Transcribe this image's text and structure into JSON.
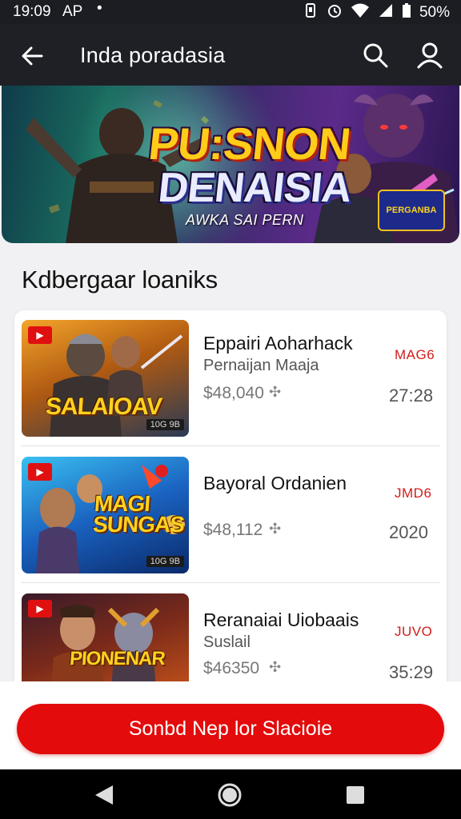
{
  "status_bar": {
    "time": "19:09",
    "carrier": "AP",
    "battery": "50%"
  },
  "app_bar": {
    "title": "Inda poradasia"
  },
  "banner": {
    "title_line1": "PU:SNON",
    "title_line2": "DENAISIA",
    "subtitle": "AWKA SAI PERN",
    "badge_text": "PERGANBA"
  },
  "section": {
    "heading": "Kdbergaar loaniks"
  },
  "items": [
    {
      "thumb_title": "SALAIOAV",
      "thumb_tag": "10G 9B",
      "title": "Eppairi Aoharhack",
      "subtitle": "Pernaijan Maaja",
      "price": "$48,040",
      "tag": "MAG6",
      "number": "27:28",
      "accent": "#c98a22"
    },
    {
      "thumb_title": "MAGI SUNGAS",
      "thumb_tag": "10G 9B",
      "title": "Bayoral Ordanien",
      "subtitle": "",
      "price": "$48,112",
      "tag": "JMD6",
      "number": "2020",
      "accent": "#1e7fd8"
    },
    {
      "thumb_title": "PIONENAR",
      "thumb_tag": "",
      "title": "Reranaiai Uiobaais",
      "subtitle": "Suslail",
      "price": "$46350",
      "tag": "JUVO",
      "number": "35:29",
      "accent": "#d24a1a"
    }
  ],
  "cta": {
    "label": "Sonbd Nep lor Slacioie"
  },
  "icons": {
    "back": "arrow-left-icon",
    "search": "search-icon",
    "profile": "person-icon",
    "nav_back": "triangle-back-icon",
    "nav_home": "circle-home-icon",
    "nav_recent": "square-recent-icon"
  },
  "colors": {
    "accent": "#e30b0b",
    "app_bar": "#1f2026",
    "tag_red": "#d21c1c"
  }
}
